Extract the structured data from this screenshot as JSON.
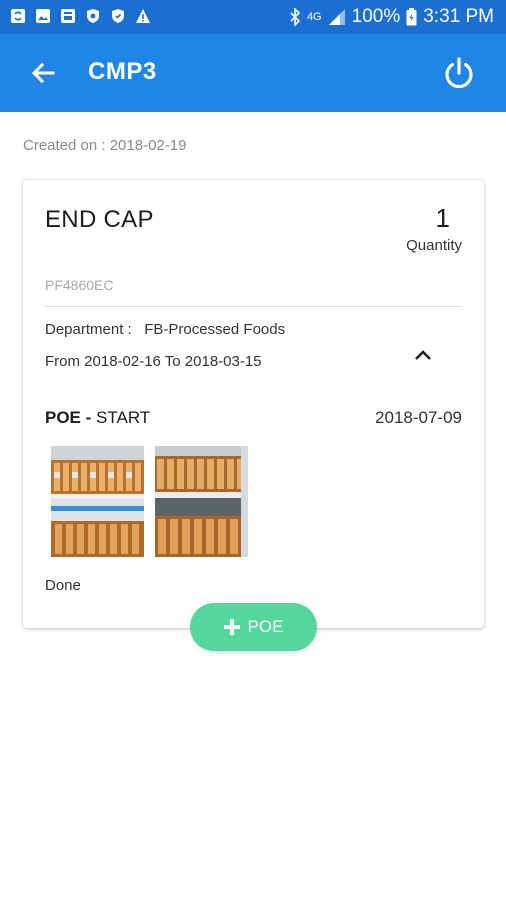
{
  "status_bar": {
    "network": "4G",
    "battery": "100%",
    "time": "3:31 PM"
  },
  "app_bar": {
    "title": "CMP3",
    "back_icon": "back-arrow-icon",
    "power_icon": "power-icon"
  },
  "created_on": "Created on : 2018-02-19",
  "card": {
    "title": "END CAP",
    "quantity": "1",
    "quantity_label": "Quantity",
    "code": "PF4860EC",
    "department": "Department :   FB-Processed Foods",
    "date_range": "From 2018-02-16 To 2018-03-15",
    "poe": {
      "prefix": "POE - ",
      "stage": "START",
      "date": "2018-07-09",
      "status": "Done"
    }
  },
  "fab": {
    "label": "POE"
  },
  "colors": {
    "status_bar": "#1a6fd0",
    "app_bar": "#1f86e8",
    "fab": "#53d79a"
  }
}
